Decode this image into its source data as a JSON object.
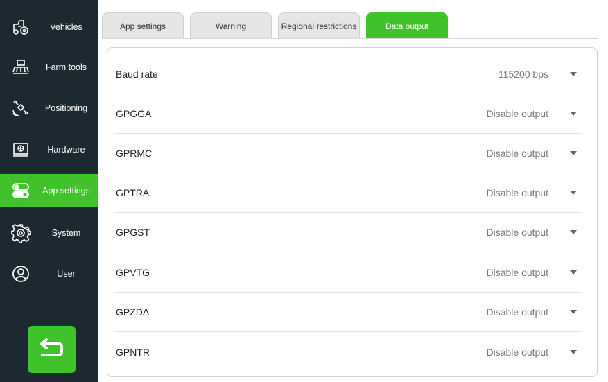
{
  "sidebar": {
    "items": [
      {
        "label": "Vehicles",
        "icon": "tractor-icon"
      },
      {
        "label": "Farm tools",
        "icon": "farm-tool-icon"
      },
      {
        "label": "Positioning",
        "icon": "satellite-icon"
      },
      {
        "label": "Hardware",
        "icon": "hardware-display-icon"
      },
      {
        "label": "App settings",
        "icon": "toggle-settings-icon",
        "active": true
      },
      {
        "label": "System",
        "icon": "gear-icon"
      },
      {
        "label": "User",
        "icon": "user-icon"
      }
    ],
    "back_icon": "back-arrow-icon"
  },
  "tabs": [
    {
      "label": "App settings"
    },
    {
      "label": "Warning"
    },
    {
      "label": "Regional restrictions"
    },
    {
      "label": "Data output",
      "active": true
    }
  ],
  "settings": [
    {
      "label": "Baud rate",
      "value": "115200 bps"
    },
    {
      "label": "GPGGA",
      "value": "Disable output"
    },
    {
      "label": "GPRMC",
      "value": "Disable output"
    },
    {
      "label": "GPTRA",
      "value": "Disable output"
    },
    {
      "label": "GPGST",
      "value": "Disable output"
    },
    {
      "label": "GPVTG",
      "value": "Disable output"
    },
    {
      "label": "GPZDA",
      "value": "Disable output"
    },
    {
      "label": "GPNTR",
      "value": "Disable output"
    }
  ],
  "colors": {
    "accent": "#3fc22a",
    "sidebar": "#1c2931"
  }
}
